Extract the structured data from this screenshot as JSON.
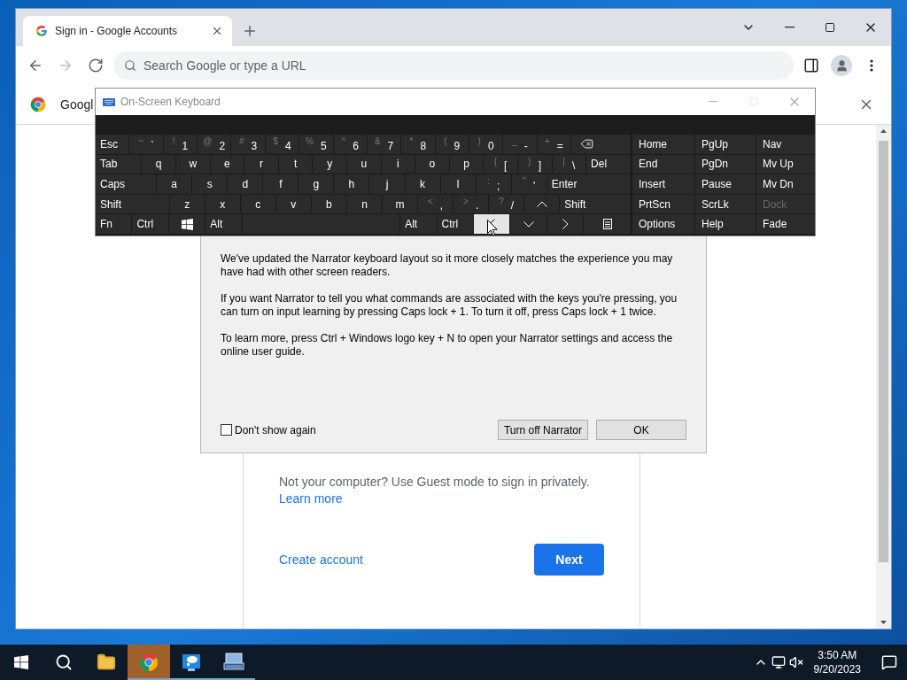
{
  "browser": {
    "tab": {
      "title": "Sign in - Google Accounts"
    },
    "nav": [
      {
        "kind": "back",
        "disabled": false
      },
      {
        "kind": "forward",
        "disabled": true
      },
      {
        "kind": "reload",
        "disabled": false
      }
    ],
    "omnibox": {
      "placeholder": "Search Google or type a URL"
    },
    "infobar": {
      "text": "Googl"
    },
    "page": {
      "guest_text": "Not your computer? Use Guest mode to sign in privately.",
      "learn_more": "Learn more",
      "create_account": "Create account",
      "next": "Next"
    }
  },
  "narrator_dialog": {
    "paragraphs": [
      "We've updated the Narrator keyboard layout so it more closely matches the experience you may have had with other screen readers.",
      "If you want Narrator to tell you what commands are associated with the keys you're pressing, you can turn on input learning by pressing Caps lock + 1. To turn it off, press Caps lock + 1 twice.",
      "To learn more, press Ctrl + Windows logo key + N to open your Narrator settings and access the online user guide."
    ],
    "checkbox": {
      "label": "Don't show again",
      "checked": false
    },
    "buttons": [
      {
        "label": "Turn off Narrator"
      },
      {
        "label": "OK"
      }
    ]
  },
  "keyboard": {
    "title": "On-Screen Keyboard",
    "main_rows": [
      [
        {
          "kind": "text",
          "label": "Esc",
          "hovered": false
        },
        {
          "kind": "char",
          "shift": "~",
          "label": "`",
          "hovered": false
        },
        {
          "kind": "char",
          "shift": "!",
          "label": "1",
          "hovered": false
        },
        {
          "kind": "char",
          "shift": "@",
          "label": "2",
          "hovered": false
        },
        {
          "kind": "char",
          "shift": "#",
          "label": "3",
          "hovered": false
        },
        {
          "kind": "char",
          "shift": "$",
          "label": "4",
          "hovered": false
        },
        {
          "kind": "char",
          "shift": "%",
          "label": "5",
          "hovered": false
        },
        {
          "kind": "char",
          "shift": "^",
          "label": "6",
          "hovered": false
        },
        {
          "kind": "char",
          "shift": "&",
          "label": "7",
          "hovered": false
        },
        {
          "kind": "char",
          "shift": "*",
          "label": "8",
          "hovered": false
        },
        {
          "kind": "char",
          "shift": "(",
          "label": "9",
          "hovered": false
        },
        {
          "kind": "char",
          "shift": ")",
          "label": "0",
          "hovered": false
        },
        {
          "kind": "char",
          "shift": "_",
          "label": "-",
          "hovered": false
        },
        {
          "kind": "char",
          "shift": "+",
          "label": "=",
          "hovered": false
        },
        {
          "kind": "backspace",
          "hovered": false
        }
      ],
      [
        {
          "kind": "text",
          "label": "Tab",
          "hovered": false
        },
        {
          "kind": "letter",
          "label": "q",
          "hovered": false
        },
        {
          "kind": "letter",
          "label": "w",
          "hovered": false
        },
        {
          "kind": "letter",
          "label": "e",
          "hovered": false
        },
        {
          "kind": "letter",
          "label": "r",
          "hovered": false
        },
        {
          "kind": "letter",
          "label": "t",
          "hovered": false
        },
        {
          "kind": "letter",
          "label": "y",
          "hovered": false
        },
        {
          "kind": "letter",
          "label": "u",
          "hovered": false
        },
        {
          "kind": "letter",
          "label": "i",
          "hovered": false
        },
        {
          "kind": "letter",
          "label": "o",
          "hovered": false
        },
        {
          "kind": "letter",
          "label": "p",
          "hovered": false
        },
        {
          "kind": "char",
          "shift": "{",
          "label": "[",
          "hovered": false
        },
        {
          "kind": "char",
          "shift": "}",
          "label": "]",
          "hovered": false
        },
        {
          "kind": "char",
          "shift": "|",
          "label": "\\",
          "hovered": false
        },
        {
          "kind": "text",
          "label": "Del",
          "hovered": false
        }
      ],
      [
        {
          "kind": "text",
          "label": "Caps",
          "hovered": false
        },
        {
          "kind": "letter",
          "label": "a",
          "hovered": false
        },
        {
          "kind": "letter",
          "label": "s",
          "hovered": false
        },
        {
          "kind": "letter",
          "label": "d",
          "hovered": false
        },
        {
          "kind": "letter",
          "label": "f",
          "hovered": false
        },
        {
          "kind": "letter",
          "label": "g",
          "hovered": false
        },
        {
          "kind": "letter",
          "label": "h",
          "hovered": false
        },
        {
          "kind": "letter",
          "label": "j",
          "hovered": false
        },
        {
          "kind": "letter",
          "label": "k",
          "hovered": false
        },
        {
          "kind": "letter",
          "label": "l",
          "hovered": false
        },
        {
          "kind": "char",
          "shift": ":",
          "label": ";",
          "hovered": false
        },
        {
          "kind": "char",
          "shift": "\"",
          "label": "'",
          "hovered": false
        },
        {
          "kind": "text",
          "label": "Enter",
          "hovered": false
        }
      ],
      [
        {
          "kind": "text",
          "label": "Shift",
          "hovered": false
        },
        {
          "kind": "letter",
          "label": "z",
          "hovered": false
        },
        {
          "kind": "letter",
          "label": "x",
          "hovered": false
        },
        {
          "kind": "letter",
          "label": "c",
          "hovered": false
        },
        {
          "kind": "letter",
          "label": "v",
          "hovered": false
        },
        {
          "kind": "letter",
          "label": "b",
          "hovered": false
        },
        {
          "kind": "letter",
          "label": "n",
          "hovered": false
        },
        {
          "kind": "letter",
          "label": "m",
          "hovered": false
        },
        {
          "kind": "char",
          "shift": "<",
          "label": ",",
          "hovered": false
        },
        {
          "kind": "char",
          "shift": ">",
          "label": ".",
          "hovered": false
        },
        {
          "kind": "char",
          "shift": "?",
          "label": "/",
          "hovered": false
        },
        {
          "kind": "up",
          "hovered": false
        },
        {
          "kind": "text",
          "label": "Shift",
          "hovered": false
        }
      ],
      [
        {
          "kind": "text",
          "label": "Fn",
          "hovered": false
        },
        {
          "kind": "text",
          "label": "Ctrl",
          "hovered": false
        },
        {
          "kind": "windows",
          "hovered": false
        },
        {
          "kind": "text",
          "label": "Alt",
          "hovered": false
        },
        {
          "kind": "space",
          "hovered": false
        },
        {
          "kind": "text",
          "label": "Alt",
          "hovered": false
        },
        {
          "kind": "text",
          "label": "Ctrl",
          "hovered": false
        },
        {
          "kind": "left",
          "hovered": true
        },
        {
          "kind": "down",
          "hovered": false
        },
        {
          "kind": "right",
          "hovered": false
        },
        {
          "kind": "menu",
          "hovered": false
        }
      ]
    ],
    "nav_rows": [
      [
        {
          "label": "Home",
          "disabled": false
        },
        {
          "label": "PgUp",
          "disabled": false
        },
        {
          "label": "Nav",
          "disabled": false
        }
      ],
      [
        {
          "label": "End",
          "disabled": false
        },
        {
          "label": "PgDn",
          "disabled": false
        },
        {
          "label": "Mv Up",
          "disabled": false
        }
      ],
      [
        {
          "label": "Insert",
          "disabled": false
        },
        {
          "label": "Pause",
          "disabled": false
        },
        {
          "label": "Mv Dn",
          "disabled": false
        }
      ],
      [
        {
          "label": "PrtScn",
          "disabled": false
        },
        {
          "label": "ScrLk",
          "disabled": false
        },
        {
          "label": "Dock",
          "disabled": true
        }
      ],
      [
        {
          "label": "Options",
          "disabled": false
        },
        {
          "label": "Help",
          "disabled": false
        },
        {
          "label": "Fade",
          "disabled": false
        }
      ]
    ]
  },
  "taskbar": {
    "apps": [
      {
        "kind": "explorer",
        "active": false,
        "running": false
      },
      {
        "kind": "chrome",
        "active": true,
        "running": true
      },
      {
        "kind": "remote",
        "active": false,
        "running": true
      },
      {
        "kind": "keyboard",
        "active": false,
        "running": true
      }
    ],
    "time": "3:50 AM",
    "date": "9/20/2023"
  }
}
